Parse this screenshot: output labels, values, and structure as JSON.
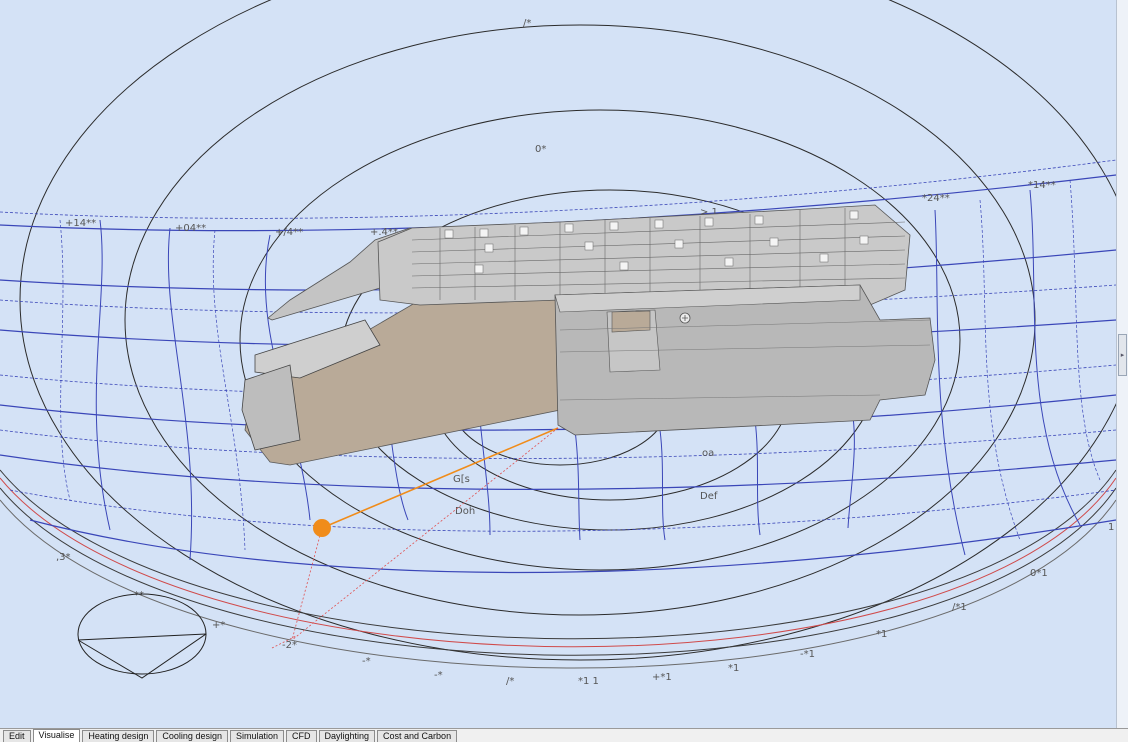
{
  "colors": {
    "sky": "#d4e2f6",
    "altitude_ring": "#2b2b2b",
    "hour_line": "#3a46b8",
    "sun": "#f08c1a",
    "building_wall": "#b9aa98",
    "building_block": "#b8b8b8"
  },
  "sunpath": {
    "altitude_labels": [
      "/*",
      "0*",
      ">.1",
      "oa",
      "Def",
      "Doh",
      "G[s"
    ],
    "hour_labels": [
      "+14**",
      "+04**",
      "+/4**",
      "+.4**",
      "*24**",
      "*14**"
    ],
    "edge_labels_right": [
      "1",
      "0*1",
      "/*1",
      "*1",
      "-*1",
      "*1",
      "+*1",
      "*1 1"
    ],
    "edge_labels_bottom": [
      "/*",
      "-*",
      "-*",
      "-*"
    ],
    "edge_labels_left": [
      ",3*",
      "+*",
      "**",
      "-2*"
    ]
  },
  "icons": {
    "sun": "sun-marker-icon",
    "compass": "compass-icon",
    "cursor": "move-cursor-icon",
    "handle": "collapse-arrow-icon"
  },
  "handle": {
    "glyph": "▸"
  },
  "tabs": [
    {
      "label": "Edit",
      "active": false
    },
    {
      "label": "Visualise",
      "active": true
    },
    {
      "label": "Heating design",
      "active": false
    },
    {
      "label": "Cooling design",
      "active": false
    },
    {
      "label": "Simulation",
      "active": false
    },
    {
      "label": "CFD",
      "active": false
    },
    {
      "label": "Daylighting",
      "active": false
    },
    {
      "label": "Cost and Carbon",
      "active": false
    }
  ]
}
